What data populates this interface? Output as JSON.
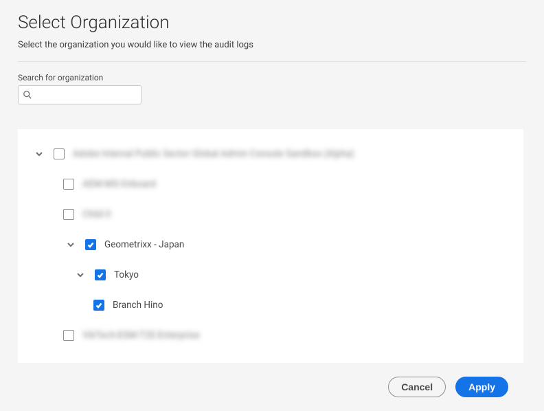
{
  "dialog": {
    "title": "Select Organization",
    "subtitle": "Select the organization you would like to view the audit logs"
  },
  "search": {
    "label": "Search for organization",
    "placeholder": ""
  },
  "tree": [
    {
      "level": 0,
      "expandable": true,
      "checked": false,
      "blurred": true,
      "label": "Adobe Internal Public Sector Global Admin Console Sandbox (Alpha)"
    },
    {
      "level": 1,
      "expandable": false,
      "checked": false,
      "blurred": true,
      "label": "AEM-MS-Onboard"
    },
    {
      "level": 1,
      "expandable": false,
      "checked": false,
      "blurred": true,
      "label": "Child 0"
    },
    {
      "level": 1,
      "expandable": true,
      "checked": true,
      "blurred": false,
      "label": "Geometrixx - Japan"
    },
    {
      "level": 2,
      "expandable": true,
      "checked": true,
      "blurred": false,
      "label": "Tokyo"
    },
    {
      "level": 3,
      "expandable": false,
      "checked": true,
      "blurred": false,
      "label": "Branch Hino"
    },
    {
      "level": 1,
      "expandable": false,
      "checked": false,
      "blurred": true,
      "label": "VikTech-ESM-T2E-Enterprise"
    }
  ],
  "buttons": {
    "cancel": "Cancel",
    "apply": "Apply"
  },
  "colors": {
    "accent": "#1473e6"
  }
}
